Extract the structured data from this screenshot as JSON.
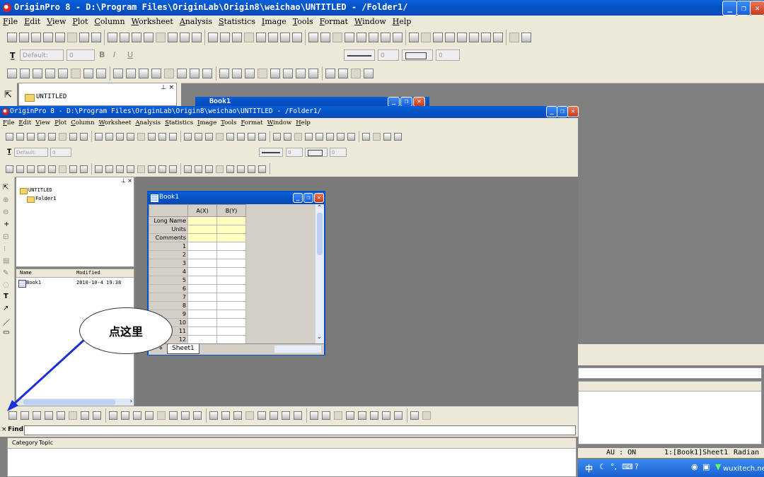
{
  "outer_window": {
    "title": "OriginPro 8 - D:\\Program Files\\OriginLab\\Origin8\\weichao\\UNTITLED - /Folder1/"
  },
  "menu": [
    "File",
    "Edit",
    "View",
    "Plot",
    "Column",
    "Worksheet",
    "Analysis",
    "Statistics",
    "Image",
    "Tools",
    "Format",
    "Window",
    "Help"
  ],
  "format_bar": {
    "font_name": "Default:",
    "font_size": "0",
    "line_width": "0",
    "fill_size": "0"
  },
  "outer_project": {
    "folder": "UNTITLED"
  },
  "bg_book": {
    "title": "Book1"
  },
  "inner_window": {
    "title": "OriginPro 8 - D:\\Program Files\\OriginLab\\Origin8\\weichao\\UNTITLED - /Folder1/",
    "font_name": "Default:",
    "font_size": "0",
    "line_width": "0",
    "fill_size": "0"
  },
  "project_explorer": {
    "root": "UNTITLED",
    "folder": "Folder1",
    "columns": [
      "Name",
      "Modified"
    ],
    "items": [
      {
        "name": "Book1",
        "modified": "2010-10-4 19:38"
      }
    ]
  },
  "book_window": {
    "title": "Book1",
    "columns": [
      "A(X)",
      "B(Y)"
    ],
    "row_labels": [
      "Long Name",
      "Units",
      "Comments"
    ],
    "row_numbers": [
      "1",
      "2",
      "3",
      "4",
      "5",
      "6",
      "7",
      "8",
      "9",
      "10",
      "11",
      "12"
    ],
    "sheet_tab": "Sheet1"
  },
  "callout": {
    "text": "点这里"
  },
  "find_bar": {
    "label": "Find:"
  },
  "help_tabs": [
    "Category",
    "Topic"
  ],
  "status_bar": {
    "mode": "AU : ON",
    "active": "1:[Book1]Sheet1",
    "units": "Radian"
  },
  "taskbar": {
    "ime": "中",
    "watermark": "wuxitech.net"
  },
  "colors": {
    "title_blue": "#0453c6",
    "workspace_gray": "#808080",
    "chrome": "#ece9d8",
    "arrow_blue": "#1a2fd8",
    "cell_yellow": "#ffffc0"
  }
}
